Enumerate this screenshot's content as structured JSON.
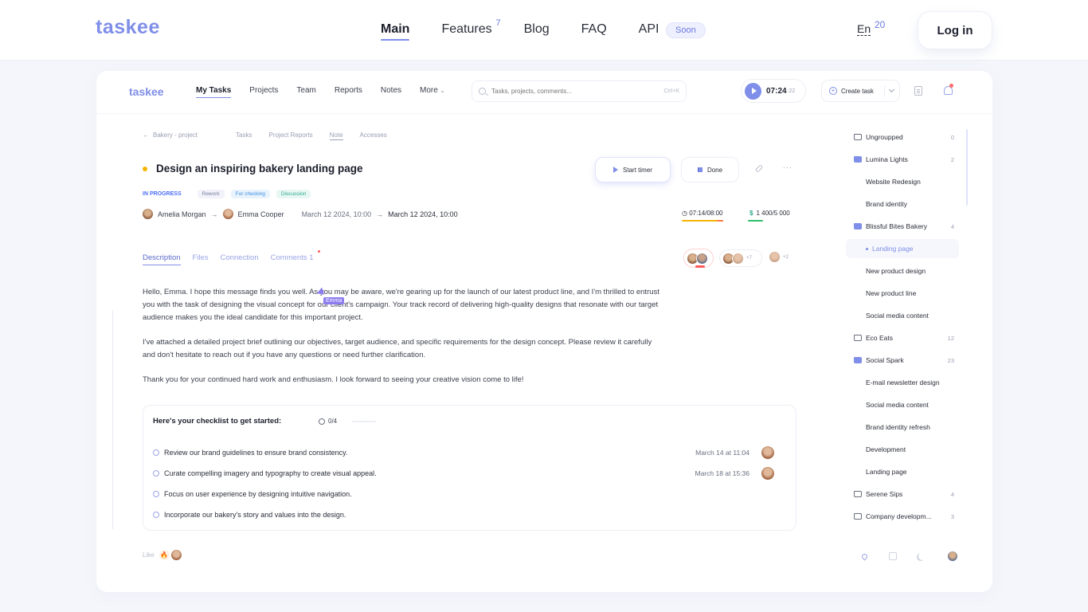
{
  "site": {
    "logo": "taskee",
    "nav": [
      {
        "label": "Main",
        "active": true
      },
      {
        "label": "Features",
        "sup": "7"
      },
      {
        "label": "Blog"
      },
      {
        "label": "FAQ"
      },
      {
        "label": "API"
      }
    ],
    "api_badge": "Soon",
    "lang": "En",
    "lang_count": "20",
    "login": "Log in"
  },
  "app": {
    "logo": "taskee",
    "nav": [
      "My Tasks",
      "Projects",
      "Team",
      "Reports",
      "Notes",
      "More"
    ],
    "search_placeholder": "Tasks, projects, comments...",
    "search_shortcut": "Ctrl+K",
    "timer": {
      "main": "07:24",
      "sec": ":22"
    },
    "create_task": "Create task"
  },
  "crumbs": {
    "back": "Bakery - project",
    "tabs": [
      "Tasks",
      "Project Reports",
      "Note",
      "Accesses"
    ],
    "active": "Note"
  },
  "task": {
    "title": "Design an inspiring bakery landing page",
    "start_timer": "Start timer",
    "done": "Done",
    "more": "···",
    "status": "IN PROGRESS",
    "tags": [
      "Rework",
      "For checking",
      "Discussion"
    ],
    "from": "Amelia Morgan",
    "to": "Emma Cooper",
    "date_start": "March 12 2024, 10:00",
    "date_end": "March 12 2024, 10:00",
    "time_spent": "07:14/08:00",
    "money_symbol": "$",
    "money": "1 400/5 000"
  },
  "sub_tabs": [
    "Description",
    "Files",
    "Connection",
    "Comments 1"
  ],
  "avatars": {
    "grp2_plus": "+7",
    "grp3_plus": "+2"
  },
  "description": [
    "Hello, Emma. I hope this message finds you well. As you may be aware, we're gearing up for the launch of our latest product line, and I'm thrilled to entrust you with the task of designing the visual concept for our client's campaign. Your track record of delivering high-quality designs that resonate with our target audience makes you the ideal candidate for this important project.",
    "I've attached a detailed project brief outlining our objectives, target audience, and specific requirements for the design concept. Please review it carefully and don't hesitate to reach out if you have any questions or need further clarification.",
    "Thank you for your continued hard work and enthusiasm. I look forward to seeing your creative vision come to life!"
  ],
  "cursor_label": "Emma",
  "checklist": {
    "title": "Here's your checklist to get started:",
    "count": "0/4",
    "items": [
      {
        "text": "Review our brand guidelines to ensure brand consistency.",
        "date": "March 14 at 11:04"
      },
      {
        "text": "Curate compelling imagery and typography to create visual appeal.",
        "date": "March 18 at 15:36"
      },
      {
        "text": "Focus on user experience by designing intuitive navigation.",
        "date": ""
      },
      {
        "text": "Incorporate our bakery's story and values into the design.",
        "date": ""
      }
    ]
  },
  "like": {
    "label": "Like",
    "emoji": "🔥"
  },
  "sidebar": [
    {
      "label": "Ungroupped",
      "count": "0",
      "type": "folder"
    },
    {
      "label": "Lumina Lights",
      "count": "2",
      "type": "folder-filled"
    },
    {
      "label": "Website Redesign",
      "type": "child"
    },
    {
      "label": "Brand identity",
      "type": "child"
    },
    {
      "label": "Blissful Bites Bakery",
      "count": "4",
      "type": "folder-filled"
    },
    {
      "label": "Landing page",
      "type": "selected"
    },
    {
      "label": "New product design",
      "type": "child"
    },
    {
      "label": "New product line",
      "type": "child"
    },
    {
      "label": "Social media content",
      "type": "child"
    },
    {
      "label": "Eco Eats",
      "count": "12",
      "type": "folder"
    },
    {
      "label": "Social Spark",
      "count": "23",
      "type": "folder-filled"
    },
    {
      "label": "E-mail newsletter design",
      "type": "child"
    },
    {
      "label": "Social media content",
      "type": "child"
    },
    {
      "label": "Brand identity refresh",
      "type": "child"
    },
    {
      "label": "Development",
      "type": "child"
    },
    {
      "label": "Landing page",
      "type": "child"
    },
    {
      "label": "Serene Sips",
      "count": "4",
      "type": "folder"
    },
    {
      "label": "Company developm...",
      "count": "3",
      "type": "folder"
    }
  ]
}
